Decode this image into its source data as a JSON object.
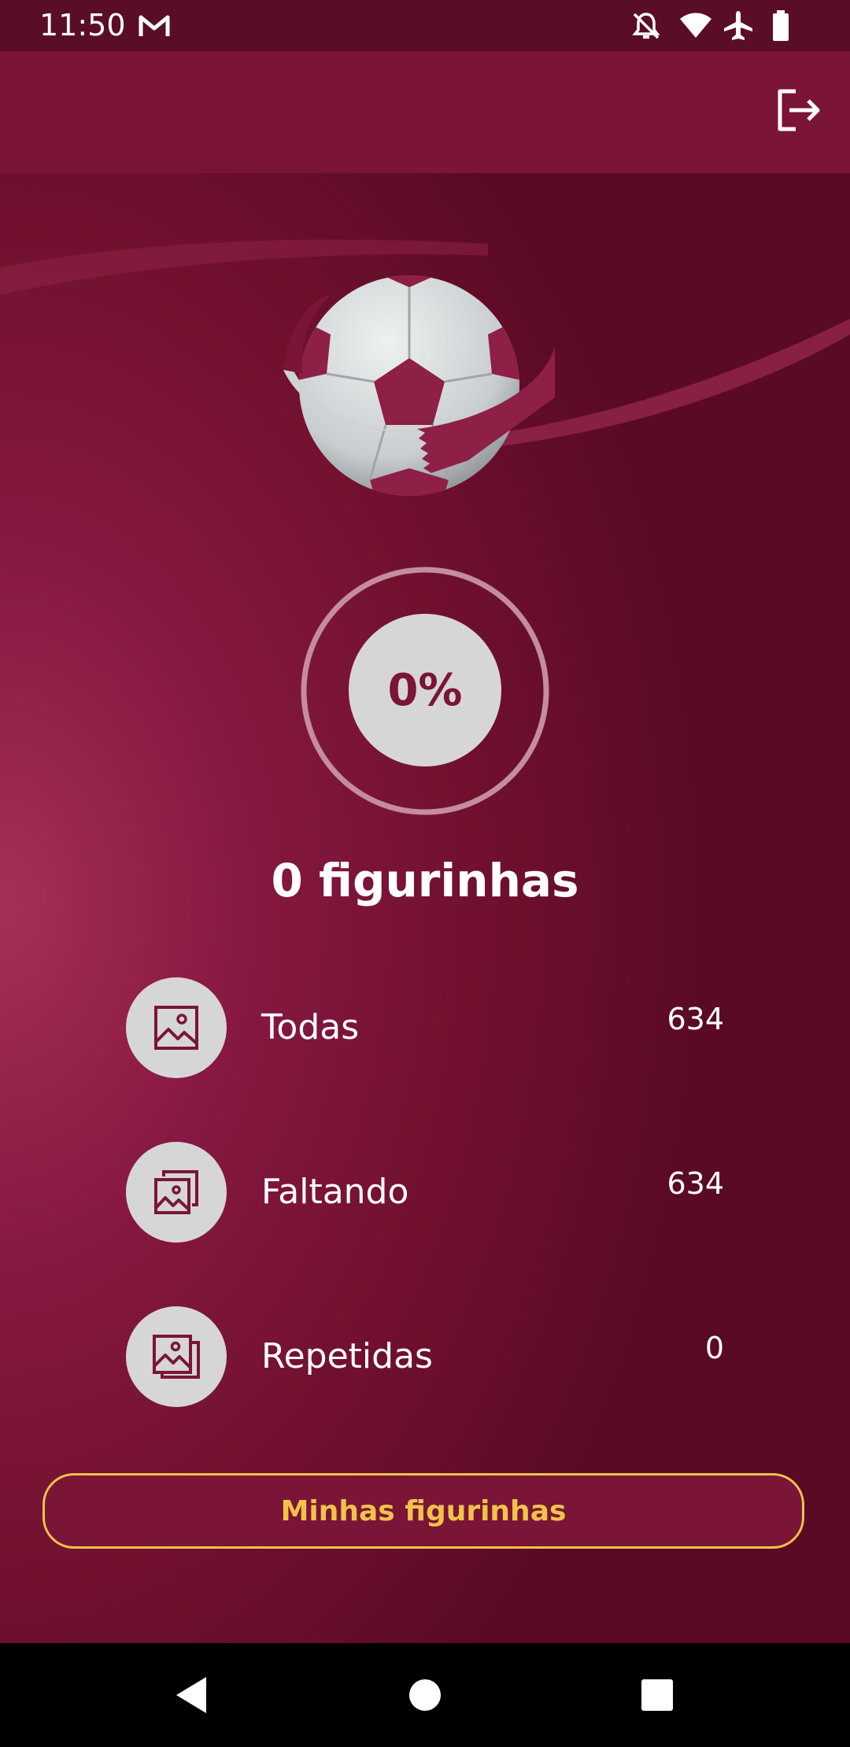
{
  "status_bar": {
    "time": "11:50",
    "icons": [
      "gmail-icon",
      "do-not-disturb-icon",
      "wifi-icon",
      "airplane-icon",
      "battery-icon"
    ]
  },
  "app_bar": {
    "action_icon": "logout-icon"
  },
  "progress": {
    "percent_label": "0%",
    "value": 0
  },
  "summary": {
    "title": "0 figurinhas"
  },
  "stats": [
    {
      "icon": "image-icon",
      "label": "Todas",
      "value": "634"
    },
    {
      "icon": "images-stack-icon",
      "label": "Faltando",
      "value": "634"
    },
    {
      "icon": "images-duplicate-icon",
      "label": "Repetidas",
      "value": "0"
    }
  ],
  "actions": {
    "primary_label": "Minhas figurinhas"
  },
  "nav_bar": {
    "icons": [
      "back-icon",
      "home-icon",
      "recents-icon"
    ]
  },
  "colors": {
    "primary": "#7a1537",
    "accent": "#f1c24a",
    "circle": "#d6d6d6"
  }
}
